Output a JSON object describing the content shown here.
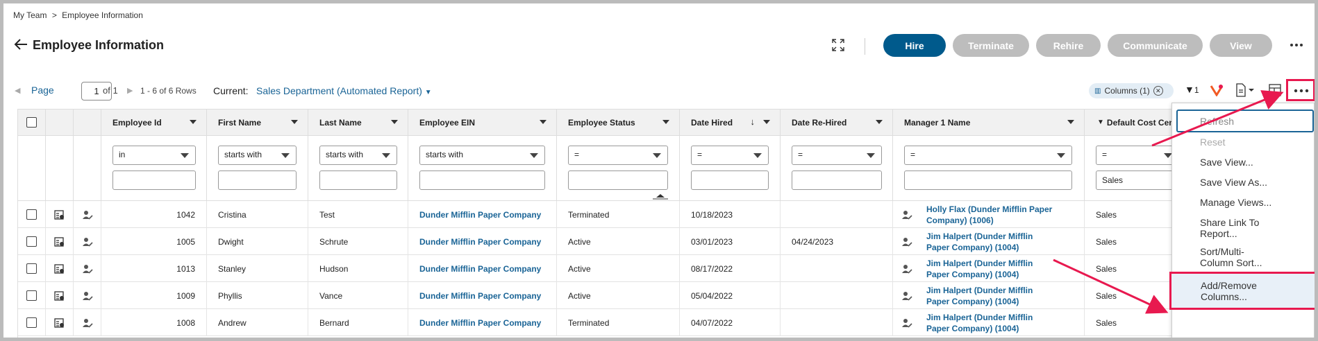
{
  "breadcrumb": [
    "My Team",
    ">",
    "Employee Information"
  ],
  "page": {
    "title": "Employee Information"
  },
  "actions": {
    "hire": "Hire",
    "terminate": "Terminate",
    "rehire": "Rehire",
    "communicate": "Communicate",
    "view": "View"
  },
  "pager": {
    "page_label": "Page",
    "page_value": "1",
    "of_label": "of",
    "of_total": "1",
    "rows_summary": "1 - 6 of 6 Rows"
  },
  "current": {
    "label": "Current:",
    "value": "Sales Department (Automated Report)"
  },
  "toolbar": {
    "columns_chip": "Columns (1)",
    "filter_count": "1"
  },
  "table": {
    "columns": [
      "Employee Id",
      "First Name",
      "Last Name",
      "Employee EIN",
      "Employee Status",
      "Date Hired",
      "Date Re-Hired",
      "Manager 1 Name",
      "Default Cost Cen"
    ],
    "filters": {
      "ops": [
        "in",
        "starts with",
        "starts with",
        "starts with",
        "=",
        "=",
        "=",
        "=",
        "="
      ],
      "values": [
        "",
        "",
        "",
        "",
        "",
        "",
        "",
        "",
        "Sales"
      ]
    },
    "rows": [
      {
        "id": "1042",
        "first": "Cristina",
        "last": "Test",
        "ein": "Dunder Mifflin Paper Company",
        "status": "Terminated",
        "hired": "10/18/2023",
        "rehired": "",
        "mgr1": "Holly Flax (Dunder Mifflin Paper",
        "mgr2": "Company) (1006)",
        "cost": "Sales"
      },
      {
        "id": "1005",
        "first": "Dwight",
        "last": "Schrute",
        "ein": "Dunder Mifflin Paper Company",
        "status": "Active",
        "hired": "03/01/2023",
        "rehired": "04/24/2023",
        "mgr1": "Jim Halpert (Dunder Mifflin",
        "mgr2": "Paper Company) (1004)",
        "cost": "Sales"
      },
      {
        "id": "1013",
        "first": "Stanley",
        "last": "Hudson",
        "ein": "Dunder Mifflin Paper Company",
        "status": "Active",
        "hired": "08/17/2022",
        "rehired": "",
        "mgr1": "Jim Halpert (Dunder Mifflin",
        "mgr2": "Paper Company) (1004)",
        "cost": "Sales"
      },
      {
        "id": "1009",
        "first": "Phyllis",
        "last": "Vance",
        "ein": "Dunder Mifflin Paper Company",
        "status": "Active",
        "hired": "05/04/2022",
        "rehired": "",
        "mgr1": "Jim Halpert (Dunder Mifflin",
        "mgr2": "Paper Company) (1004)",
        "cost": "Sales"
      },
      {
        "id": "1008",
        "first": "Andrew",
        "last": "Bernard",
        "ein": "Dunder Mifflin Paper Company",
        "status": "Terminated",
        "hired": "04/07/2022",
        "rehired": "",
        "mgr1": "Jim Halpert (Dunder Mifflin",
        "mgr2": "Paper Company) (1004)",
        "cost": "Sales"
      }
    ]
  },
  "menu": {
    "items": [
      {
        "label": "Refresh"
      },
      {
        "label": "Reset"
      },
      {
        "label": "Save View..."
      },
      {
        "label": "Save View As..."
      },
      {
        "label": "Manage Views..."
      },
      {
        "label": "Share Link To",
        "label2": "Report..."
      },
      {
        "label": "Sort/Multi-",
        "label2": "Column Sort..."
      },
      {
        "label": "Add/Remove",
        "label2": "Columns..."
      }
    ]
  },
  "colors": {
    "primary": "#005a8c",
    "link": "#1a6496",
    "annotation": "#e8194f",
    "disabled": "#bdbdbd"
  },
  "icons": [
    "back-arrow-icon",
    "expand-icon",
    "more-icon",
    "filter-icon",
    "brand-logo-icon",
    "export-icon",
    "layout-icon",
    "employee-card-icon",
    "edit-person-icon",
    "manager-person-icon"
  ]
}
